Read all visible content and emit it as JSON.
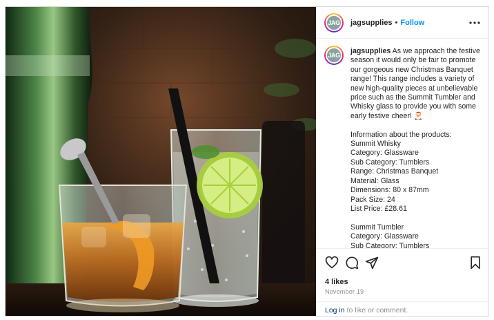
{
  "post": {
    "username": "jagsupplies",
    "avatar_text": "JAG",
    "separator": "•",
    "follow_label": "Follow",
    "caption_user": "jagsupplies",
    "caption_text": "As we approach the festive season it would only be fair to promote our gorgeous new Christmas Banquet range! This range includes a variety of new high-quality pieces at unbelievable price such as the Summit Tumbler and Whisky glass to provide you with some early festive cheer! 🎅\n\nInformation about the products:\nSummit Whisky\nCategory: Glassware\nSub Category: Tumblers\nRange: Christmas Banquet\nMaterial: Glass\nDimensions: 80 x 87mm\nPack Size: 24\nList Price: £28.61\n\nSummit Tumbler\nCategory: Glassware\nSub Category: Tumblers",
    "likes": "4 likes",
    "date": "November 19",
    "login_link": "Log in",
    "login_suffix": "to like or comment."
  },
  "icons": {
    "more": "more-options-icon",
    "like": "heart-icon",
    "comment": "comment-icon",
    "share": "share-icon",
    "save": "bookmark-icon"
  },
  "colors": {
    "follow": "#0095f6",
    "link": "#00376b",
    "muted": "#8e8e8e",
    "text": "#262626"
  }
}
